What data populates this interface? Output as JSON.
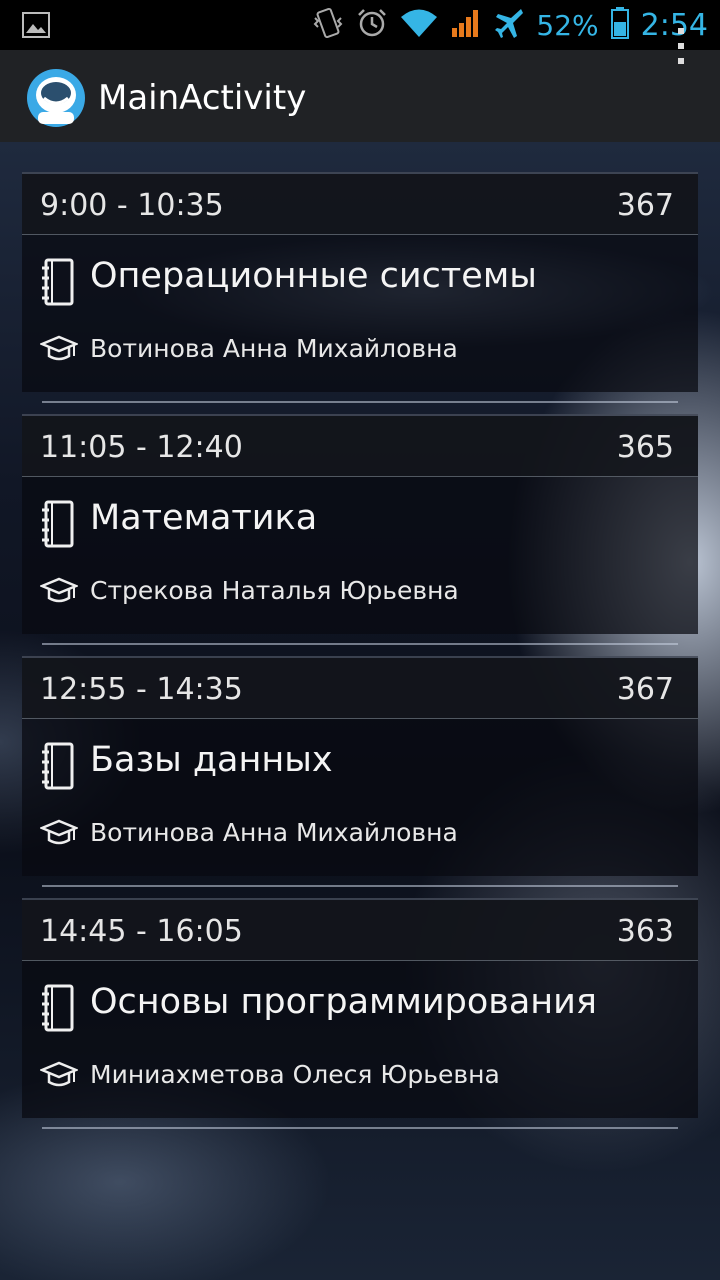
{
  "status_bar": {
    "battery_percent": "52%",
    "time": "2:54",
    "icons": [
      "image-icon",
      "vibrate-icon",
      "alarm-icon",
      "wifi-icon",
      "signal-icon",
      "airplane-icon",
      "battery-icon"
    ]
  },
  "action_bar": {
    "title": "MainActivity",
    "icon": "app-logo-icon"
  },
  "colors": {
    "accent": "#35b5e5",
    "action_bar": "#202225",
    "card": "#0a0c12"
  },
  "schedule": [
    {
      "time": "9:00 - 10:35",
      "room": "367",
      "subject": "Операционные системы",
      "teacher": "Вотинова Анна Михайловна"
    },
    {
      "time": "11:05 - 12:40",
      "room": "365",
      "subject": "Математика",
      "teacher": "Стрекова Наталья Юрьевна"
    },
    {
      "time": "12:55 - 14:35",
      "room": "367",
      "subject": "Базы данных",
      "teacher": "Вотинова Анна Михайловна"
    },
    {
      "time": "14:45 - 16:05",
      "room": "363",
      "subject": "Основы программирования",
      "teacher": "Миниахметова Олеся Юрьевна"
    }
  ]
}
